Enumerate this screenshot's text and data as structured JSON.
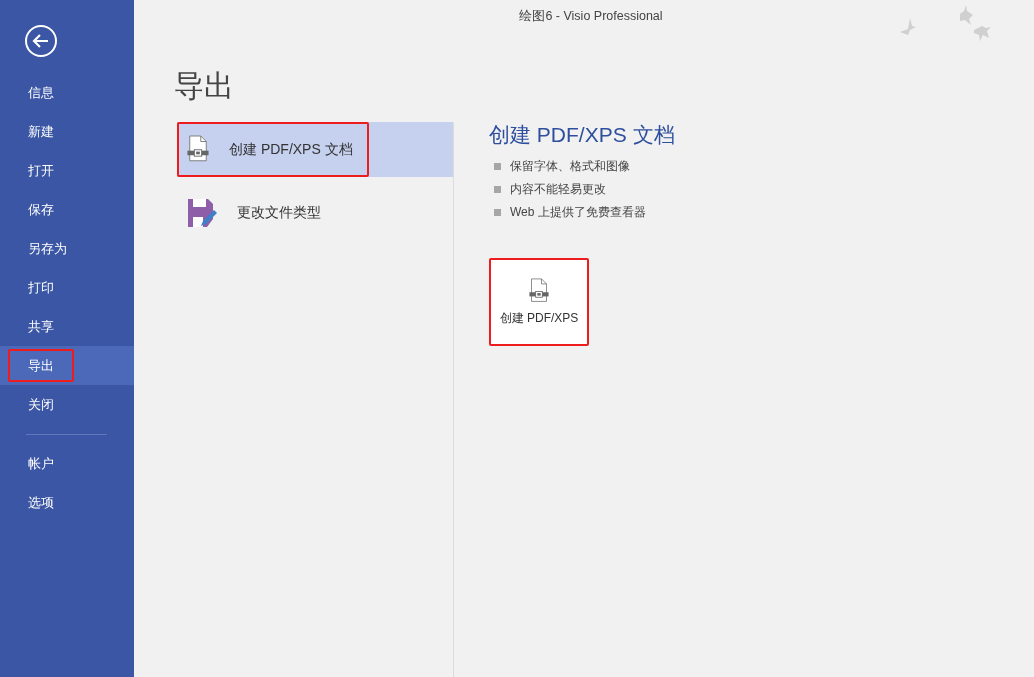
{
  "window": {
    "title": "绘图6 - Visio Professional"
  },
  "sidebar": {
    "items": [
      {
        "label": "信息",
        "selected": false,
        "highlighted": false
      },
      {
        "label": "新建",
        "selected": false,
        "highlighted": false
      },
      {
        "label": "打开",
        "selected": false,
        "highlighted": false
      },
      {
        "label": "保存",
        "selected": false,
        "highlighted": false
      },
      {
        "label": "另存为",
        "selected": false,
        "highlighted": false
      },
      {
        "label": "打印",
        "selected": false,
        "highlighted": false
      },
      {
        "label": "共享",
        "selected": false,
        "highlighted": false
      },
      {
        "label": "导出",
        "selected": true,
        "highlighted": true
      },
      {
        "label": "关闭",
        "selected": false,
        "highlighted": false
      }
    ],
    "bottom_items": [
      {
        "label": "帐户",
        "selected": false,
        "highlighted": false
      },
      {
        "label": "选项",
        "selected": false,
        "highlighted": false
      }
    ]
  },
  "page": {
    "title": "导出",
    "options": [
      {
        "kind": "pdf",
        "label": "创建 PDF/XPS 文档",
        "selected": true,
        "highlighted": true
      },
      {
        "kind": "filetype",
        "label": "更改文件类型",
        "selected": false,
        "highlighted": false
      }
    ],
    "detail": {
      "title": "创建 PDF/XPS 文档",
      "bullets": [
        "保留字体、格式和图像",
        "内容不能轻易更改",
        "Web 上提供了免费查看器"
      ],
      "button": {
        "kind": "pdf",
        "label": "创建 PDF/XPS",
        "highlighted": true
      }
    }
  }
}
